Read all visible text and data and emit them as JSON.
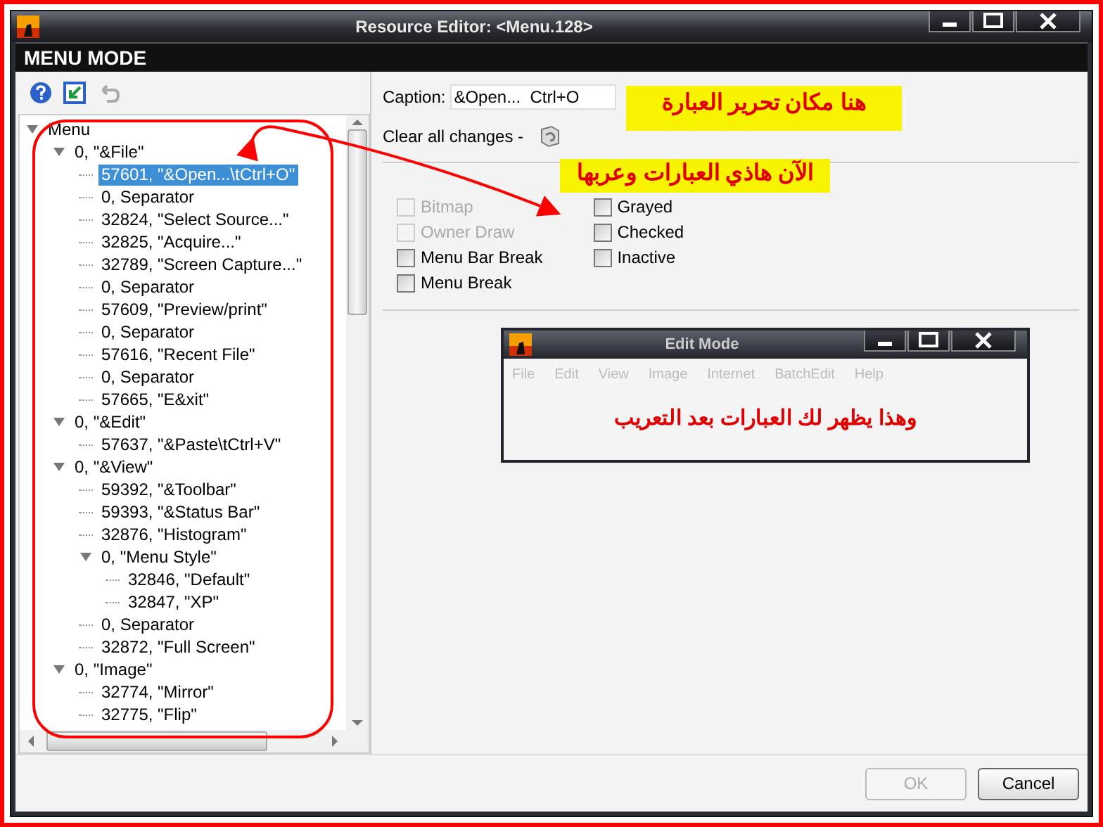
{
  "window": {
    "title": "Resource Editor: <Menu.128>",
    "mode_title": "MENU MODE"
  },
  "tree": {
    "items": [
      {
        "label": "Menu",
        "expanded": true,
        "selected": false,
        "children": [
          {
            "label": "0, \"&File\"",
            "expanded": true,
            "selected": false,
            "children": [
              {
                "label": "57601, \"&Open...\\tCtrl+O\"",
                "selected": true
              },
              {
                "label": "0, Separator",
                "selected": false
              },
              {
                "label": "32824, \"Select Source...\"",
                "selected": false
              },
              {
                "label": "32825, \"Acquire...\"",
                "selected": false
              },
              {
                "label": "32789, \"Screen Capture...\"",
                "selected": false
              },
              {
                "label": "0, Separator",
                "selected": false
              },
              {
                "label": "57609, \"Preview/print\"",
                "selected": false
              },
              {
                "label": "0, Separator",
                "selected": false
              },
              {
                "label": "57616, \"Recent File\"",
                "selected": false
              },
              {
                "label": "0, Separator",
                "selected": false
              },
              {
                "label": "57665, \"E&xit\"",
                "selected": false
              }
            ]
          },
          {
            "label": "0, \"&Edit\"",
            "expanded": true,
            "selected": false,
            "children": [
              {
                "label": "57637, \"&Paste\\tCtrl+V\"",
                "selected": false
              }
            ]
          },
          {
            "label": "0, \"&View\"",
            "expanded": true,
            "selected": false,
            "children": [
              {
                "label": "59392, \"&Toolbar\"",
                "selected": false
              },
              {
                "label": "59393, \"&Status Bar\"",
                "selected": false
              },
              {
                "label": "32876, \"Histogram\"",
                "selected": false
              },
              {
                "label": "0, \"Menu Style\"",
                "expanded": true,
                "selected": false,
                "children": [
                  {
                    "label": "32846, \"Default\"",
                    "selected": false
                  },
                  {
                    "label": "32847, \"XP\"",
                    "selected": false
                  }
                ]
              },
              {
                "label": "0, Separator",
                "selected": false
              },
              {
                "label": "32872, \"Full Screen\"",
                "selected": false
              }
            ]
          },
          {
            "label": "0, \"Image\"",
            "expanded": true,
            "selected": false,
            "children": [
              {
                "label": "32774, \"Mirror\"",
                "selected": false
              },
              {
                "label": "32775, \"Flip\"",
                "selected": false
              }
            ]
          }
        ]
      }
    ]
  },
  "caption": {
    "label": "Caption:",
    "value": "&Open...  Ctrl+O"
  },
  "clear_changes": {
    "label": "Clear all changes -"
  },
  "option_columns": [
    [
      {
        "label": "Bitmap",
        "checked": false,
        "disabled": true
      },
      {
        "label": "Owner Draw",
        "checked": false,
        "disabled": true
      },
      {
        "label": "Menu Bar Break",
        "checked": false,
        "disabled": false
      },
      {
        "label": "Menu Break",
        "checked": false,
        "disabled": false
      }
    ],
    [
      {
        "label": "Grayed",
        "checked": false,
        "disabled": false
      },
      {
        "label": "Checked",
        "checked": false,
        "disabled": false
      },
      {
        "label": "Inactive",
        "checked": false,
        "disabled": false
      }
    ]
  ],
  "preview": {
    "title": "Edit Mode",
    "menus": [
      {
        "label": "File",
        "disabled": true
      },
      {
        "label": "Edit",
        "disabled": true
      },
      {
        "label": "View",
        "disabled": true
      },
      {
        "label": "Image",
        "disabled": true
      },
      {
        "label": "Internet",
        "disabled": true
      },
      {
        "label": "BatchEdit",
        "disabled": true
      },
      {
        "label": "Help",
        "disabled": true
      }
    ],
    "note": "وهذا يظهر لك العبارات بعد التعريب"
  },
  "annotations": [
    {
      "text": "هنا مكان تحرير العبارة"
    },
    {
      "text": "الآن هاذي العبارات وعربها"
    }
  ],
  "buttons": [
    {
      "label": "OK",
      "disabled": true
    },
    {
      "label": "Cancel",
      "disabled": false
    }
  ]
}
